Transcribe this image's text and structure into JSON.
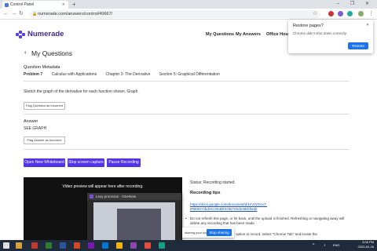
{
  "browser": {
    "tab_title": "Control Panel",
    "url": "numerade.com/answers/control/40667/",
    "new_tab": "+",
    "win_controls": "– ❐ ✕"
  },
  "restore_popup": {
    "title": "Restore pages?",
    "message": "Chrome didn't shut down correctly.",
    "button": "Restore"
  },
  "site": {
    "logo": "Numerade",
    "nav": [
      "My Questions",
      "My Answers",
      "Office Hours"
    ]
  },
  "page": {
    "title": "My Questions",
    "metadata_heading": "Question Metadata",
    "problem": "Problem 7",
    "crumbs": [
      "Calculus with Applications",
      "Chapter 3: The Derivative",
      "Section 5: Graphical Differentiation"
    ],
    "instruction": "Sketch the graph of the derivative for each function shown. Graph.",
    "flag_question": "Flag Question as Incorrect",
    "answer_heading": "Answer",
    "answer_value": "SEE GRAPH",
    "flag_answer": "Flag Answer as Incorrect"
  },
  "actions": {
    "whiteboard": "Open New Whiteboard",
    "stop_capture": "Stop screen capture",
    "pause": "Pause Recording"
  },
  "video": {
    "placeholder": "Video preview will appear here after recording."
  },
  "recording": {
    "status": "Status: Recording started.",
    "tips_heading": "Recording tips",
    "link": "https://docs.google.com/document/d/1mUVOcx7-IPB004YlbdHCz9nBEXOkr/YDdm9Efd/edit",
    "tip1": "Do not refresh this page, or hit back, until the upload is finished. Refreshing or navigating away will delete any recording that has been made.",
    "tip2": "option to record, select \"Chrome Tab\" and locate the"
  },
  "overlay": {
    "title": "Lexy procesan - OneNote"
  },
  "share_bar": {
    "text": "sharing your screen.",
    "stop": "Stop sharing",
    "hide": "Hide"
  },
  "taskbar": {
    "time": "3:06 PM",
    "date": "2020-02-26",
    "lang": "ENG"
  },
  "colors": {
    "primary": "#5135e8",
    "logo": "#3b2a9a",
    "chrome_blue": "#1a73e8"
  }
}
